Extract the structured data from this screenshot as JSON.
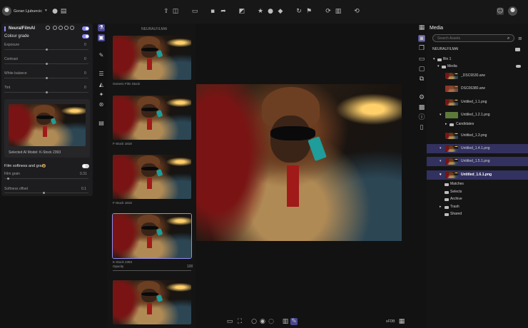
{
  "topbar": {
    "user_name": "Goran Ljubuncic",
    "user_chevron": "▾"
  },
  "left_panel": {
    "title": "NeuralFilmAI",
    "colour_grade": "Colour grade",
    "sliders": [
      {
        "label": "Exposure",
        "value": "0",
        "level": 0.5
      },
      {
        "label": "Contrast",
        "value": "0",
        "level": 0.5
      },
      {
        "label": "White balance",
        "value": "0",
        "level": 0.5
      },
      {
        "label": "Tint",
        "value": "0",
        "level": 0.5
      }
    ],
    "selected_model": "Selected AI Model: K-Stock 2393",
    "film_softness": "Film softness and grain",
    "film_grain_label": "Film grain",
    "film_grain_value": "0.31",
    "softness_label": "Softness offset",
    "softness_value": "0.1"
  },
  "film_strip": {
    "header": "NEURALFILMAI",
    "items": [
      {
        "caption": "Generic Film Stock"
      },
      {
        "caption": "F-Stock 1818"
      },
      {
        "caption": "F-Stock 1819"
      },
      {
        "caption": "K-Stock 2393"
      },
      {
        "caption": ""
      }
    ],
    "opacity_label": "Opacity",
    "opacity_value": "100",
    "opacity_level": 1.0
  },
  "viewer": {
    "zoom": "sFDB"
  },
  "media": {
    "title": "Media",
    "search_placeholder": "Search Assets",
    "root": "NEURALFILMAI",
    "bin": "Bin 1",
    "media_folder": "Media",
    "files": [
      {
        "name": "_DSC6530.arw",
        "selected": false
      },
      {
        "name": "DSC06380.arw",
        "selected": false
      },
      {
        "name": "Untitled_1.1.png",
        "selected": false
      },
      {
        "name": "Untitled_1.2.1.png",
        "selected": false
      },
      {
        "name": "Candidates",
        "selected": false
      },
      {
        "name": "Untitled_1.3.png",
        "selected": false
      },
      {
        "name": "Untitled_1.4.1.png",
        "selected": true
      },
      {
        "name": "Untitled_1.5.1.png",
        "selected": true
      },
      {
        "name": "Untitled_1.6.1.png",
        "selected": true
      }
    ],
    "folders": [
      "Matches",
      "Selects",
      "Archive",
      "Trash",
      "Shared"
    ]
  }
}
